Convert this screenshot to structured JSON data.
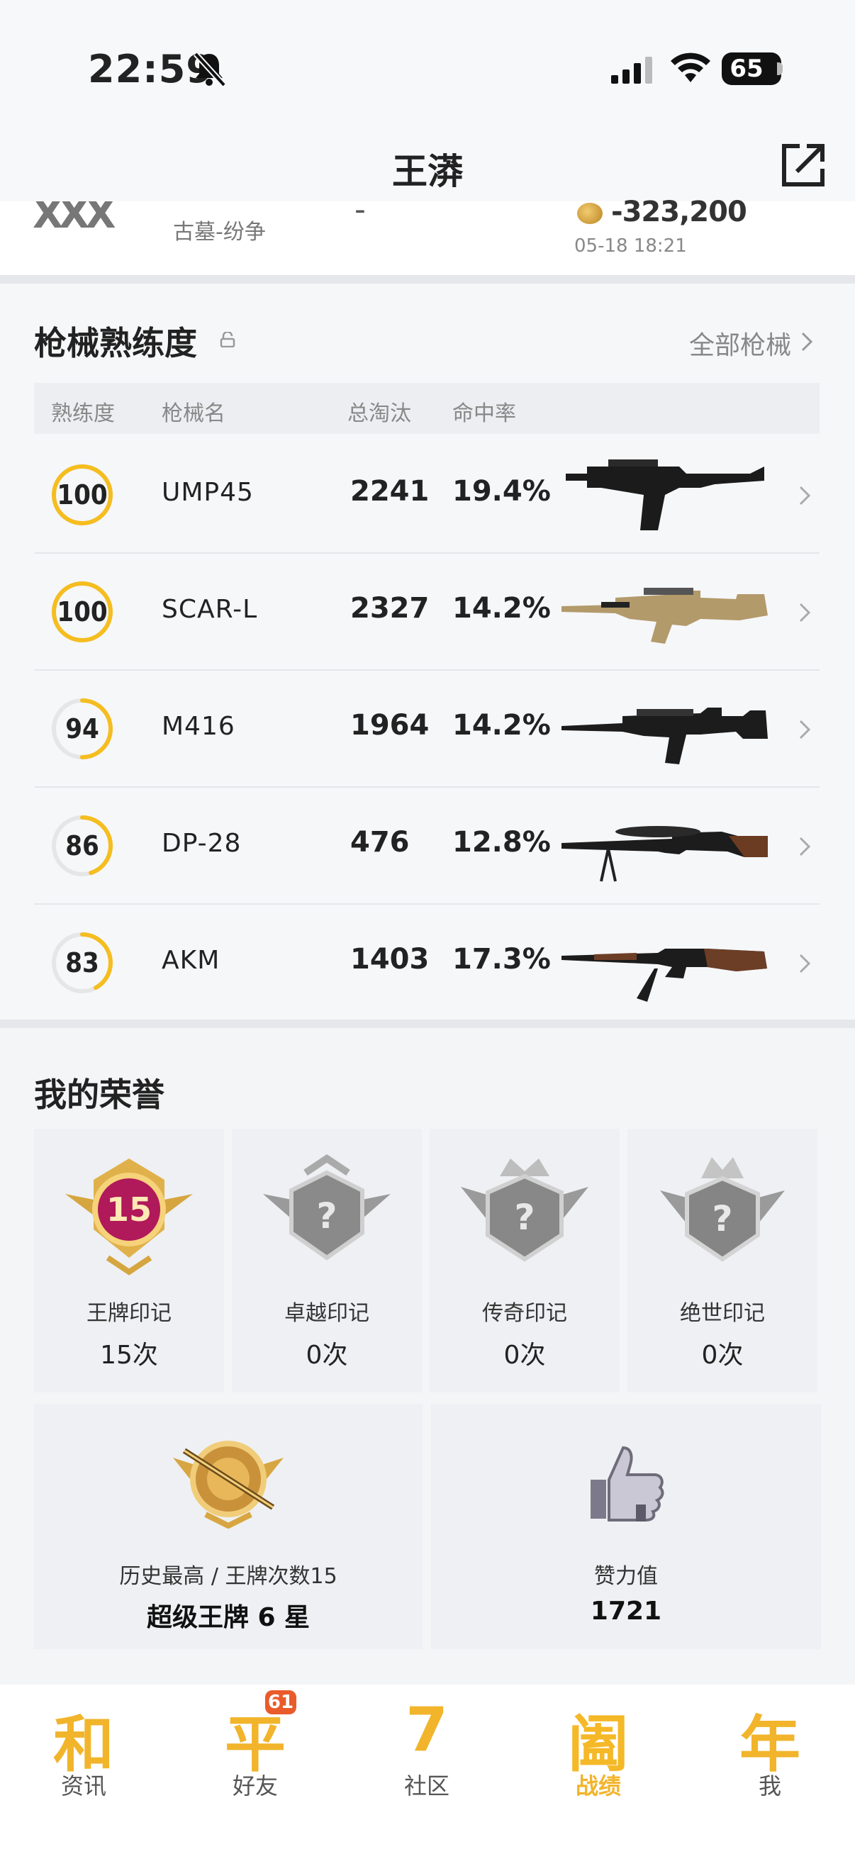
{
  "status_bar": {
    "time": "22:59",
    "battery": "65",
    "icons": [
      "bell-muted-icon",
      "signal-icon",
      "wifi-icon",
      "battery-icon"
    ]
  },
  "header": {
    "title": "王漭",
    "share_icon": "share-icon"
  },
  "partial_item": {
    "badge": "XXX",
    "map": "古墓-纷争",
    "dash": "-",
    "amount": "-323,200",
    "date": "05-18 18:21"
  },
  "weapon_section": {
    "title": "枪械熟练度",
    "all_link": "全部枪械",
    "columns": [
      "熟练度",
      "枪械名",
      "总淘汰",
      "命中率"
    ],
    "rows": [
      {
        "proficiency": "100",
        "level": 1.0,
        "name": "UMP45",
        "kills": "2241",
        "hit_rate": "19.4%",
        "gun": "ump45"
      },
      {
        "proficiency": "100",
        "level": 1.0,
        "name": "SCAR-L",
        "kills": "2327",
        "hit_rate": "14.2%",
        "gun": "scar-l"
      },
      {
        "proficiency": "94",
        "level": 0.5,
        "name": "M416",
        "kills": "1964",
        "hit_rate": "14.2%",
        "gun": "m416"
      },
      {
        "proficiency": "86",
        "level": 0.45,
        "name": "DP-28",
        "kills": "476",
        "hit_rate": "12.8%",
        "gun": "dp-28"
      },
      {
        "proficiency": "83",
        "level": 0.42,
        "name": "AKM",
        "kills": "1403",
        "hit_rate": "17.3%",
        "gun": "akm"
      }
    ]
  },
  "honors": {
    "title": "我的荣誉",
    "marks": [
      {
        "label": "王牌印记",
        "count": "15次",
        "badge_number": "15"
      },
      {
        "label": "卓越印记",
        "count": "0次",
        "badge_number": "?"
      },
      {
        "label": "传奇印记",
        "count": "0次",
        "badge_number": "?"
      },
      {
        "label": "绝世印记",
        "count": "0次",
        "badge_number": "?"
      }
    ],
    "highest": {
      "label": "历史最高 / 王牌次数15",
      "value": "超级王牌 6 星"
    },
    "likes": {
      "label": "赞力值",
      "value": "1721"
    }
  },
  "tabbar": {
    "tabs": [
      {
        "glyph": "和",
        "label": "资讯",
        "active": false
      },
      {
        "glyph": "平",
        "label": "好友",
        "active": false,
        "badge": "61"
      },
      {
        "glyph": "7",
        "label": "社区",
        "active": false
      },
      {
        "glyph": "阖",
        "label": "战绩",
        "active": true
      },
      {
        "glyph": "年",
        "label": "我",
        "active": false
      }
    ]
  },
  "colors": {
    "accent": "#f1b42b",
    "ring": "#f5bd1f",
    "ring_bg": "#e6e6e6",
    "badge": "#e95b2b"
  }
}
